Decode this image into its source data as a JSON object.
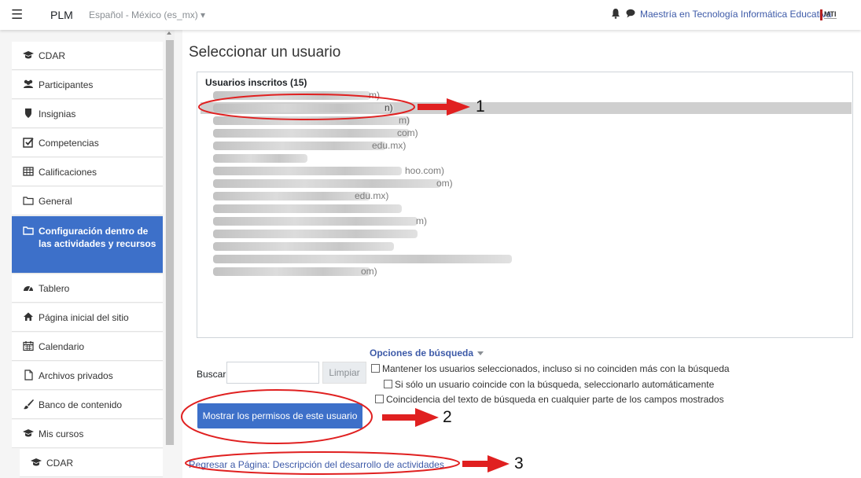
{
  "navbar": {
    "menu_icon": "hamburger-icon",
    "brand": "PLM",
    "language": "Español - México (es_mx)",
    "username": "Maestría en Tecnología Informática Educativa",
    "logo_text": "MTI"
  },
  "sidebar": {
    "items": [
      {
        "label": "CDAR",
        "icon": "graduation-cap-icon"
      },
      {
        "label": "Participantes",
        "icon": "users-icon"
      },
      {
        "label": "Insignias",
        "icon": "shield-icon"
      },
      {
        "label": "Competencias",
        "icon": "check-square-icon"
      },
      {
        "label": "Calificaciones",
        "icon": "table-icon"
      },
      {
        "label": "General",
        "icon": "folder-icon"
      },
      {
        "label": "Configuración dentro de las actividades y recursos",
        "icon": "folder-icon",
        "active": true
      },
      {
        "label": "Tablero",
        "icon": "dashboard-icon"
      },
      {
        "label": "Página inicial del sitio",
        "icon": "home-icon"
      },
      {
        "label": "Calendario",
        "icon": "calendar-icon"
      },
      {
        "label": "Archivos privados",
        "icon": "file-icon"
      },
      {
        "label": "Banco de contenido",
        "icon": "paint-brush-icon"
      },
      {
        "label": "Mis cursos",
        "icon": "graduation-cap-icon"
      },
      {
        "label": "CDAR",
        "icon": "graduation-cap-icon"
      }
    ]
  },
  "main": {
    "title": "Seleccionar un usuario",
    "group_label": "Usuarios inscritos (15)",
    "user_suffixes": [
      "m)",
      "n)",
      "m)",
      "com)",
      "edu.mx)",
      "",
      "hoo.com)",
      "om)",
      "edu.mx)",
      "",
      "m)",
      "",
      "",
      "",
      "om)"
    ],
    "search": {
      "options_link": "Opciones de búsqueda",
      "label": "Buscar",
      "value": "",
      "clear_label": "Limpiar",
      "options": [
        "Mantener los usuarios seleccionados, incluso si no coinciden más con la búsqueda",
        "Si sólo un usuario coincide con la búsqueda, seleccionarlo automáticamente",
        "Coincidencia del texto de búsqueda en cualquier parte de los campos mostrados"
      ]
    },
    "show_button": "Mostrar los permisos de este usuario",
    "back_link": "Regresar a Página: Descripción del desarrollo de actividades"
  },
  "annotations": {
    "color": "#e02020",
    "labels": [
      "1",
      "2",
      "3"
    ]
  }
}
